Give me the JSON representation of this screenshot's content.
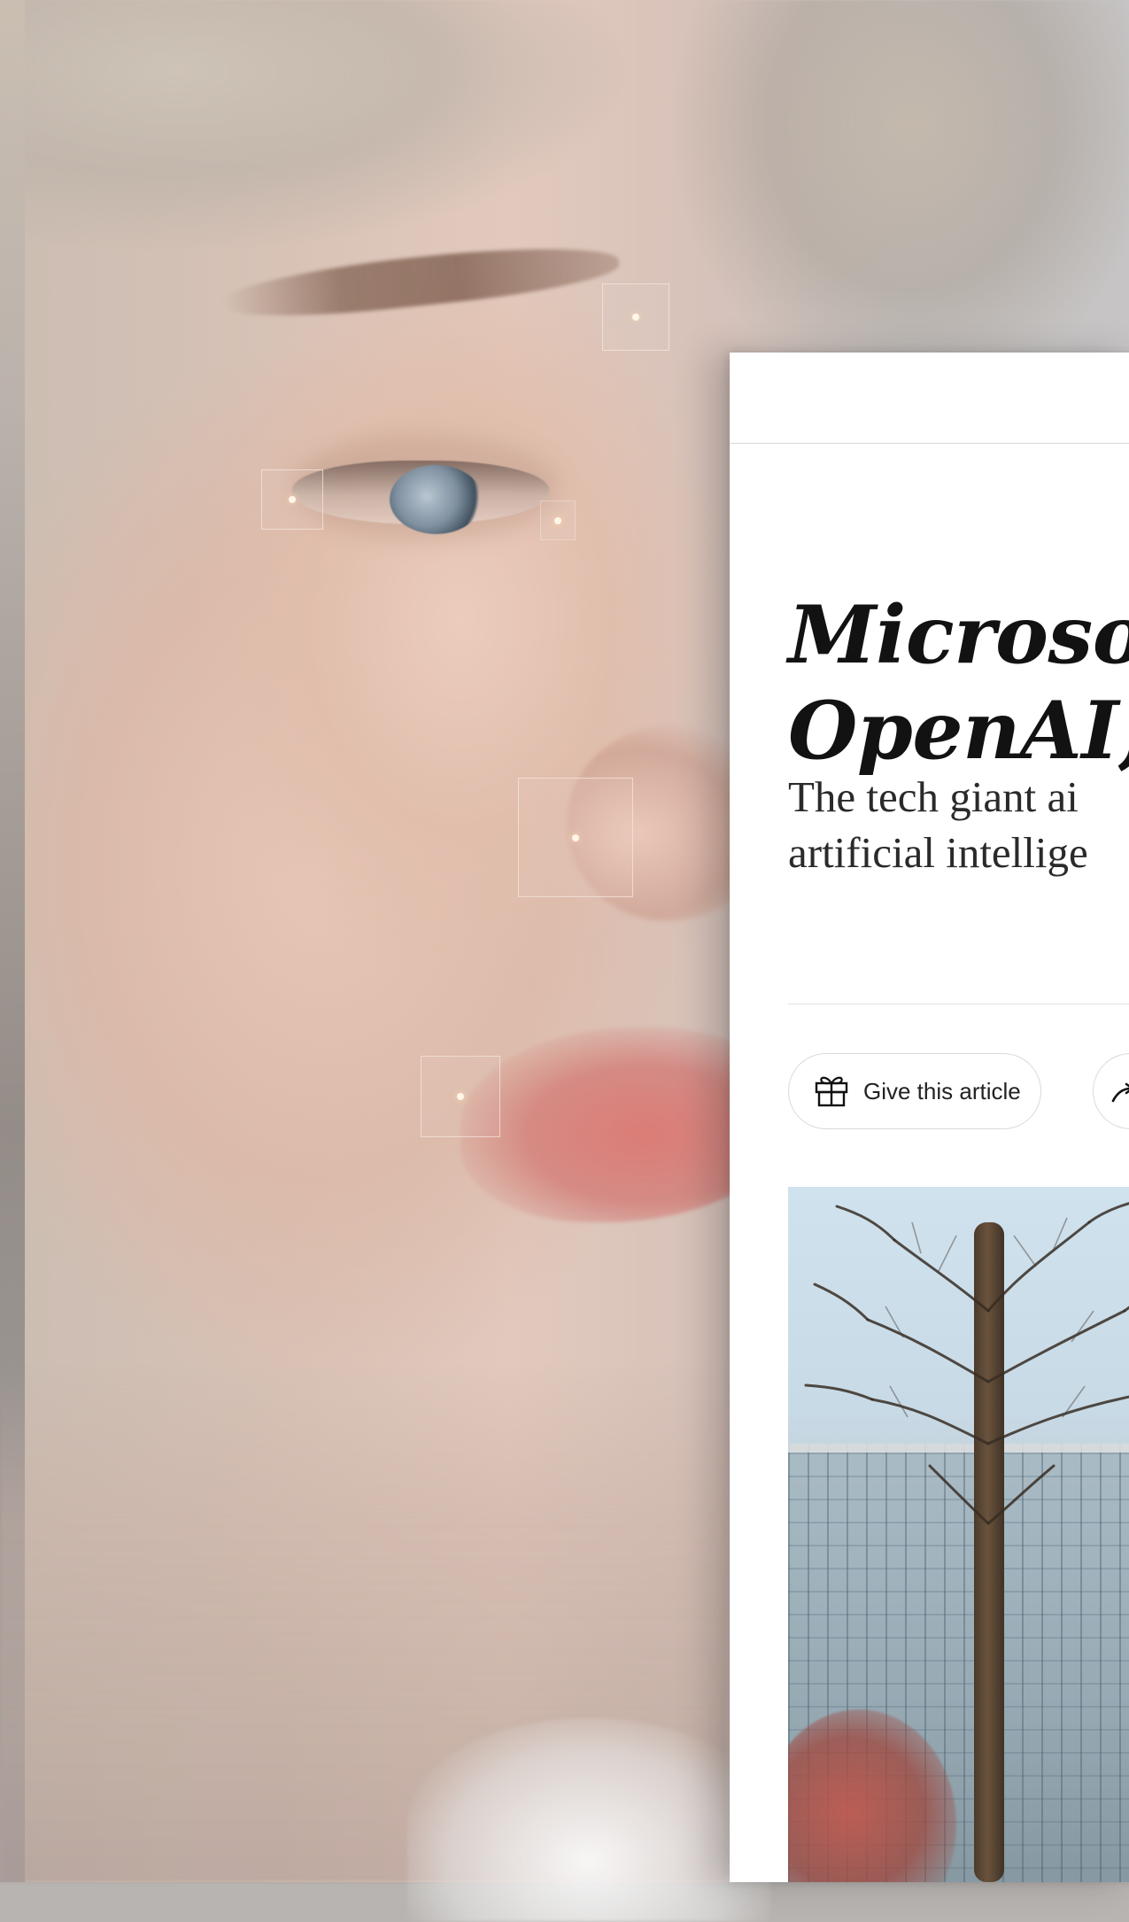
{
  "article": {
    "headline": "Microsoft\nOpenAI, t",
    "dek": "The tech giant ai\nartificial intellige",
    "give_article_label": "Give this article"
  },
  "icons": {
    "gift": "gift-icon",
    "share": "share-icon"
  },
  "colors": {
    "panel_bg": "#ffffff",
    "text": "#121212",
    "button_border": "#dadada",
    "marker_dot": "#fff6e8"
  }
}
